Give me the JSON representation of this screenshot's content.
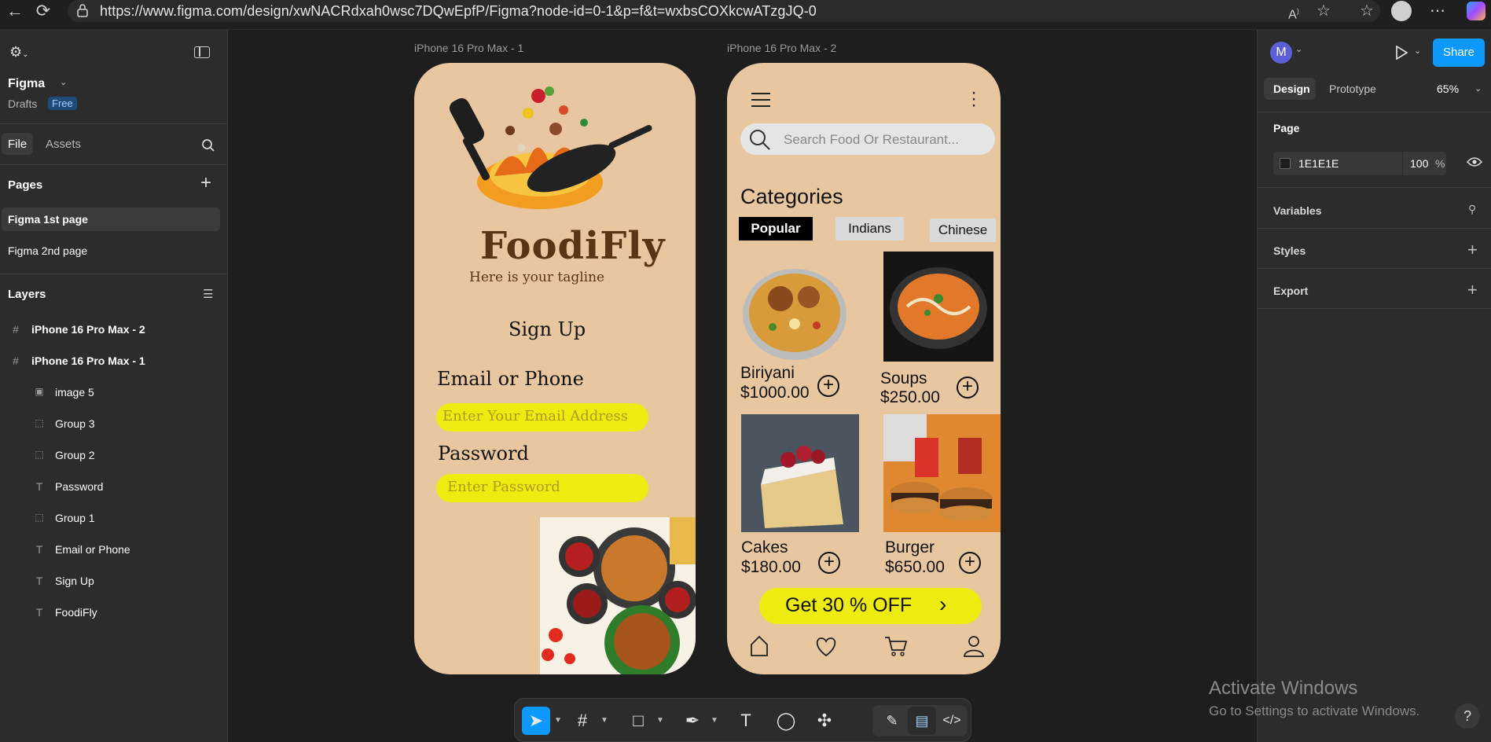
{
  "browser": {
    "url": "https://www.figma.com/design/xwNACRdxah0wsc7DQwEpfP/Figma?node-id=0-1&p=f&t=wxbsCOXkcwATzgJQ-0"
  },
  "left_panel": {
    "file_name": "Figma",
    "location": "Drafts",
    "plan_badge": "Free",
    "tabs": [
      "File",
      "Assets"
    ],
    "pages_heading": "Pages",
    "pages": [
      "Figma 1st page",
      "Figma 2nd page"
    ],
    "layers_heading": "Layers",
    "layers": [
      {
        "name": "iPhone 16 Pro Max - 2",
        "icon": "frame-icon"
      },
      {
        "name": "iPhone 16 Pro Max - 1",
        "icon": "frame-icon"
      },
      {
        "name": "image 5",
        "icon": "image-icon"
      },
      {
        "name": "Group 3",
        "icon": "group-icon"
      },
      {
        "name": "Group 2",
        "icon": "group-icon"
      },
      {
        "name": "Password",
        "icon": "text-icon"
      },
      {
        "name": "Group 1",
        "icon": "group-icon"
      },
      {
        "name": "Email or Phone",
        "icon": "text-icon"
      },
      {
        "name": "Sign Up",
        "icon": "text-icon"
      },
      {
        "name": "FoodiFly",
        "icon": "text-icon"
      }
    ]
  },
  "canvas": {
    "frame1": {
      "label": "iPhone 16 Pro Max - 1",
      "logo": "FoodiFly",
      "tagline": "Here is your tagline",
      "heading": "Sign Up",
      "email_label": "Email or Phone",
      "email_placeholder": "Enter Your Email Address",
      "password_label": "Password",
      "password_placeholder": "Enter Password"
    },
    "frame2": {
      "label": "iPhone 16 Pro Max - 2",
      "search_placeholder": "Search Food Or Restaurant...",
      "categories_heading": "Categories",
      "chips": [
        "Popular",
        "Indians",
        "Chinese"
      ],
      "items": [
        {
          "name": "Biriyani",
          "price": "$1000.00"
        },
        {
          "name": "Soups",
          "price": "$250.00"
        },
        {
          "name": "Cakes",
          "price": "$180.00"
        },
        {
          "name": "Burger",
          "price": "$650.00"
        }
      ],
      "offer": "Get 30 % OFF"
    }
  },
  "right_panel": {
    "avatar": "M",
    "share": "Share",
    "tabs": [
      "Design",
      "Prototype"
    ],
    "zoom": "65%",
    "page_heading": "Page",
    "bg_color": "1E1E1E",
    "opacity": "100",
    "percent": "%",
    "sections": [
      "Variables",
      "Styles",
      "Export"
    ]
  },
  "windows": {
    "line1": "Activate Windows",
    "line2": "Go to Settings to activate Windows."
  },
  "colors": {
    "accent": "#0d99ff",
    "phone_bg": "#e8c6a0",
    "field": "#eeeb11"
  }
}
